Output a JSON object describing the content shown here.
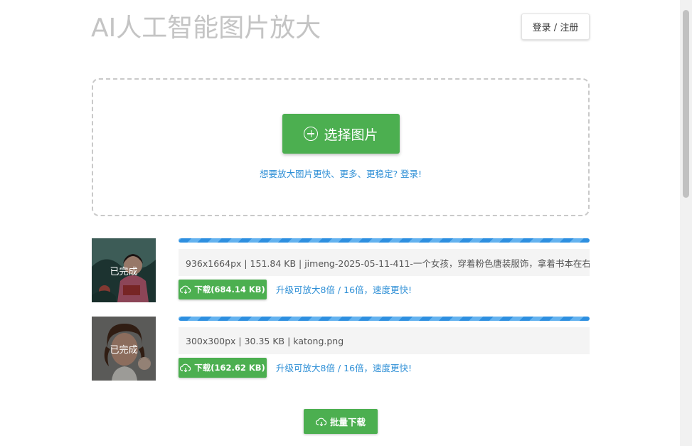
{
  "header": {
    "title": "AI人工智能图片放大",
    "login_label": "登录 / 注册"
  },
  "upload": {
    "choose_label": "选择图片",
    "hint": "想要放大图片更快、更多、更稳定? 登录!"
  },
  "results": [
    {
      "status": "已完成",
      "info": "936x1664px | 151.84 KB | jimeng-2025-05-11-411-一个女孩，穿着粉色唐装服饰，拿着书本在右",
      "download_label": "下载(684.14 KB)",
      "upgrade": "升级可放大8倍 / 16倍，速度更快!",
      "progress": 1.0
    },
    {
      "status": "已完成",
      "info": "300x300px | 30.35 KB | katong.png",
      "download_label": "下载(162.62 KB)",
      "upgrade": "升级可放大8倍 / 16倍，速度更快!",
      "progress": 1.0
    }
  ],
  "batch_download_label": "批量下载",
  "colors": {
    "primary_green": "#4caf50",
    "link_blue": "#2e8fd6",
    "title_gray": "#c4c4c4"
  },
  "icons": {
    "choose": "plus-circle-icon",
    "download": "cloud-download-icon"
  }
}
